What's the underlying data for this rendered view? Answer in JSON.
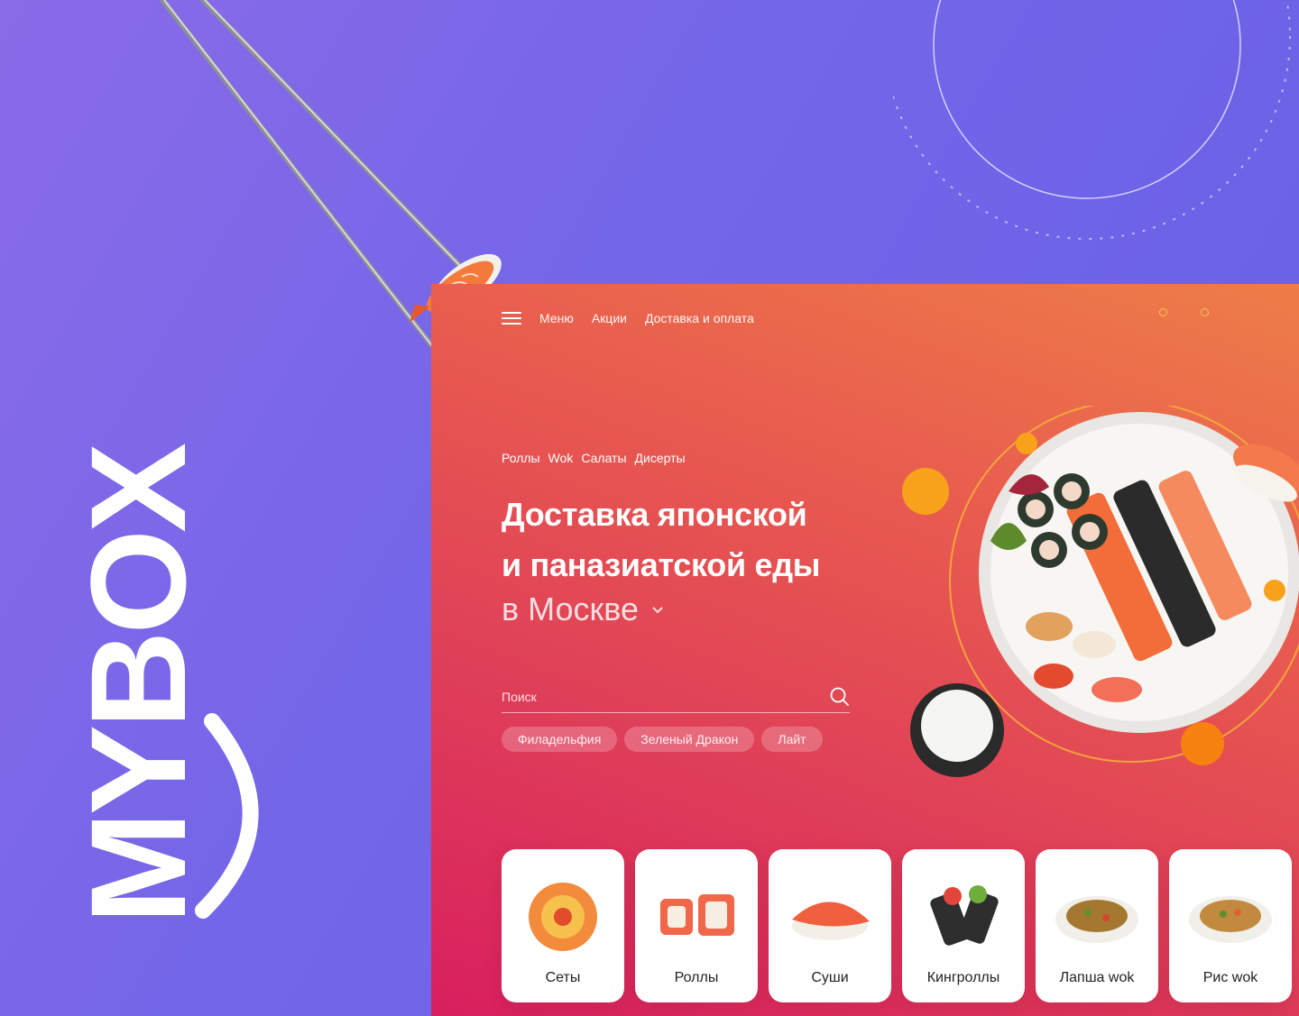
{
  "brand": {
    "logo_text": "MYBOX"
  },
  "nav": {
    "items": [
      "Меню",
      "Акции",
      "Доставка и оплата"
    ]
  },
  "categories": [
    "Роллы",
    "Wok",
    "Салаты",
    "Дисерты"
  ],
  "hero": {
    "line1": "Доставка японской",
    "line2": "и паназиатской еды",
    "city": "в Москве"
  },
  "search": {
    "placeholder": "Поиск"
  },
  "chips": [
    "Филадельфия",
    "Зеленый Дракон",
    "Лайт"
  ],
  "cards": [
    {
      "label": "Сеты",
      "icon": "sushi-set-icon"
    },
    {
      "label": "Роллы",
      "icon": "rolls-icon"
    },
    {
      "label": "Суши",
      "icon": "nigiri-icon"
    },
    {
      "label": "Кингроллы",
      "icon": "king-roll-icon"
    },
    {
      "label": "Лапша wok",
      "icon": "noodles-icon"
    },
    {
      "label": "Рис wok",
      "icon": "rice-wok-icon"
    }
  ],
  "colors": {
    "background": "#7466e8",
    "site_gradient_start": "#ee7d48",
    "site_gradient_end": "#d81f5f",
    "accent_yellow": "#f6c75a",
    "card_bg": "#ffffff"
  }
}
